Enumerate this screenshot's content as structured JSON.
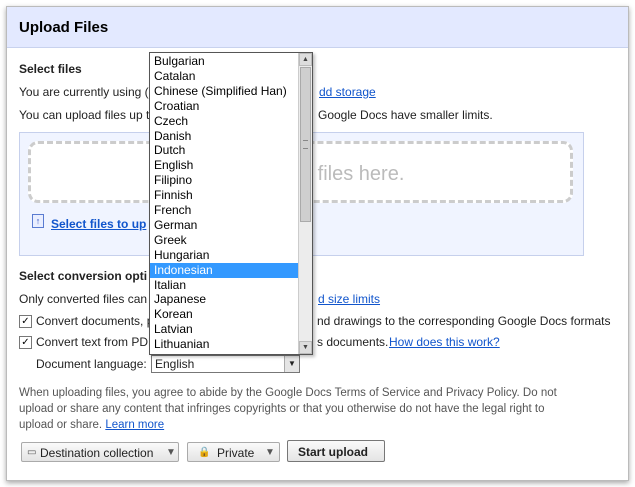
{
  "dialog": {
    "title": "Upload Files"
  },
  "select_files": {
    "heading": "Select files",
    "storage_text": "You are currently using (",
    "add_storage": "dd storage",
    "limits_prefix": "You can upload files up t",
    "limits_suffix": "Google Docs have smaller limits.",
    "drop_text": "o files here.",
    "select_link": "Select files to up"
  },
  "conversion": {
    "heading": "Select conversion opti",
    "only_converted": "Only converted files can",
    "size_limits_link": "d size limits",
    "convert_docs_prefix": "Convert documents, p",
    "convert_docs_suffix": "nd drawings to the corresponding Google Docs formats",
    "convert_docs_checked": true,
    "convert_pdf_prefix": "Convert text from PDF",
    "convert_pdf_suffix": "s documents.",
    "how_link": "How does this work?",
    "convert_pdf_checked": true,
    "language_label": "Document language:",
    "language_value": "English"
  },
  "language_dropdown": {
    "selected": "Indonesian",
    "options": [
      "Bulgarian",
      "Catalan",
      "Chinese (Simplified Han)",
      "Croatian",
      "Czech",
      "Danish",
      "Dutch",
      "English",
      "Filipino",
      "Finnish",
      "French",
      "German",
      "Greek",
      "Hungarian",
      "Indonesian",
      "Italian",
      "Japanese",
      "Korean",
      "Latvian",
      "Lithuanian"
    ]
  },
  "legal": {
    "text": "When uploading files, you agree to abide by the Google Docs Terms of Service and Privacy Policy. Do not upload or share any content that infringes copyrights or that you otherwise do not have the legal right to upload or share.",
    "learn_more": "Learn more"
  },
  "footer": {
    "destination": "Destination collection",
    "privacy": "Private",
    "start_upload": "Start upload"
  }
}
